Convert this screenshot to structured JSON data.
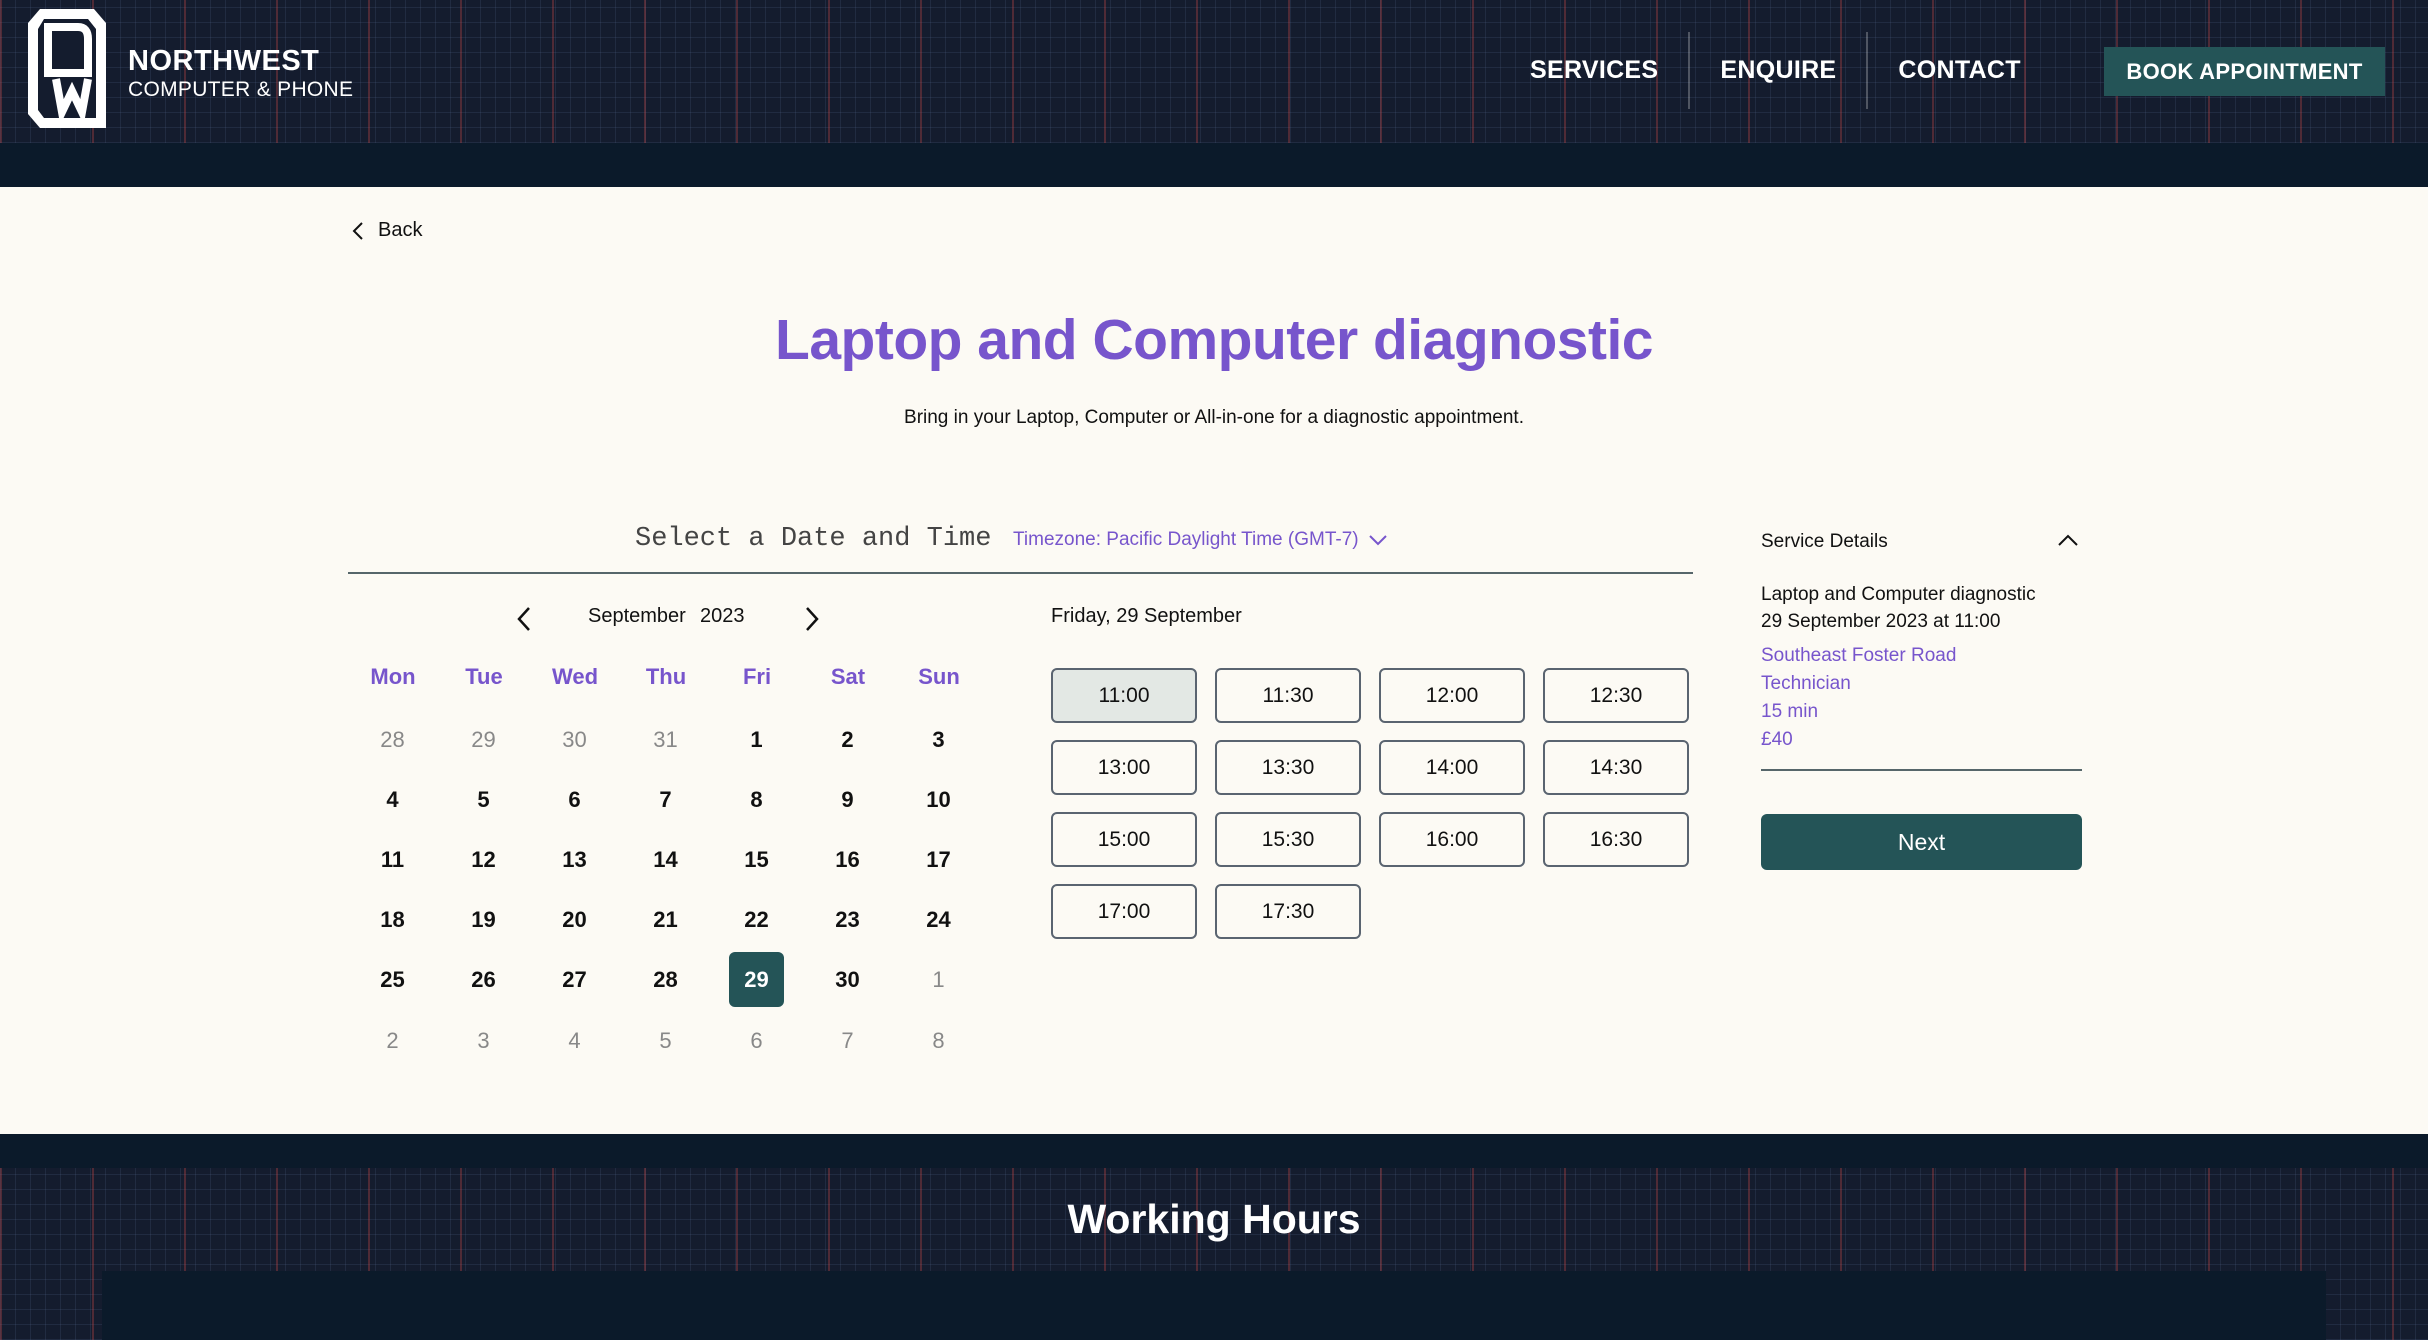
{
  "header": {
    "brand_name": "NORTHWEST",
    "brand_sub": "COMPUTER & PHONE",
    "nav": [
      "SERVICES",
      "ENQUIRE",
      "CONTACT"
    ],
    "book_button": "BOOK APPOINTMENT"
  },
  "main": {
    "back_label": "Back",
    "title": "Laptop and Computer diagnostic",
    "subtitle": "Bring in your Laptop, Computer or All-in-one for a diagnostic appointment.",
    "select_heading": "Select a Date and Time",
    "timezone": "Timezone: Pacific Daylight Time (GMT-7)"
  },
  "calendar": {
    "month": "September",
    "year": "2023",
    "weekdays": [
      "Mon",
      "Tue",
      "Wed",
      "Thu",
      "Fri",
      "Sat",
      "Sun"
    ],
    "weeks": [
      [
        "28",
        "29",
        "30",
        "31",
        "1",
        "2",
        "3"
      ],
      [
        "4",
        "5",
        "6",
        "7",
        "8",
        "9",
        "10"
      ],
      [
        "11",
        "12",
        "13",
        "14",
        "15",
        "16",
        "17"
      ],
      [
        "18",
        "19",
        "20",
        "21",
        "22",
        "23",
        "24"
      ],
      [
        "25",
        "26",
        "27",
        "28",
        "29",
        "30",
        "1"
      ],
      [
        "2",
        "3",
        "4",
        "5",
        "6",
        "7",
        "8"
      ]
    ],
    "selected_day": "29"
  },
  "times": {
    "date_label": "Friday, 29 September",
    "slots": [
      "11:00",
      "11:30",
      "12:00",
      "12:30",
      "13:00",
      "13:30",
      "14:00",
      "14:30",
      "15:00",
      "15:30",
      "16:00",
      "16:30",
      "17:00",
      "17:30"
    ],
    "selected_slot": "11:00"
  },
  "service": {
    "heading": "Service Details",
    "name": "Laptop and Computer diagnostic",
    "when": "29 September 2023 at 11:00",
    "location": "Southeast Foster Road",
    "staff": "Technician",
    "duration": "15 min",
    "price": "£40",
    "next_label": "Next"
  },
  "footer": {
    "title": "Working Hours"
  },
  "colors": {
    "accent": "#7755cc",
    "brand_teal": "#245457",
    "header_bg": "#141c2e",
    "page_bg": "#fcfaf4"
  }
}
